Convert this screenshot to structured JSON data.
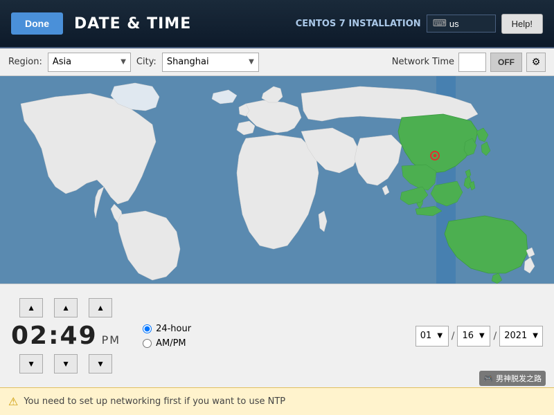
{
  "header": {
    "title": "DATE & TIME",
    "done_label": "Done",
    "centos_label": "CENTOS 7 INSTALLATION",
    "search_placeholder": "us",
    "help_label": "Help!",
    "keyboard_icon": "⌨"
  },
  "toolbar": {
    "region_label": "Region:",
    "region_value": "Asia",
    "city_label": "City:",
    "city_value": "Shanghai",
    "network_time_label": "Network Time",
    "nt_toggle_label": "OFF",
    "nt_gear": "⚙"
  },
  "time": {
    "hours": "02",
    "minutes": "49",
    "ampm": "PM",
    "format_24h": "24-hour",
    "format_ampm": "AM/PM"
  },
  "date": {
    "month": "01",
    "day": "16",
    "year": "2021",
    "separator": "/"
  },
  "warning": {
    "icon": "⚠",
    "text": "You need to set up networking first if you want to use NTP"
  },
  "watermark": {
    "icon": "🎮",
    "text": "男神脱发之路"
  },
  "map": {
    "ocean_color": "#5a8ab0",
    "land_color": "#ffffff",
    "highlight_color": "#4caf50",
    "timezone_color": "#3a7ab0"
  }
}
